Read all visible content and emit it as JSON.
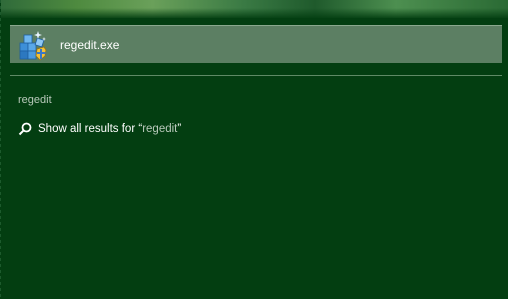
{
  "search_result": {
    "label_name": "regedit",
    "label_ext": ".exe",
    "icon": "registry-editor-icon"
  },
  "query": {
    "text": "regedit"
  },
  "show_all": {
    "prefix": "Show all results for ",
    "open_quote": "“",
    "term": "regedit",
    "close_quote": "”",
    "icon": "search-icon"
  },
  "colors": {
    "background": "#033e11",
    "highlight": "#5c7f63",
    "divider": "#5f8a66",
    "muted_text": "#b9c9bb"
  }
}
